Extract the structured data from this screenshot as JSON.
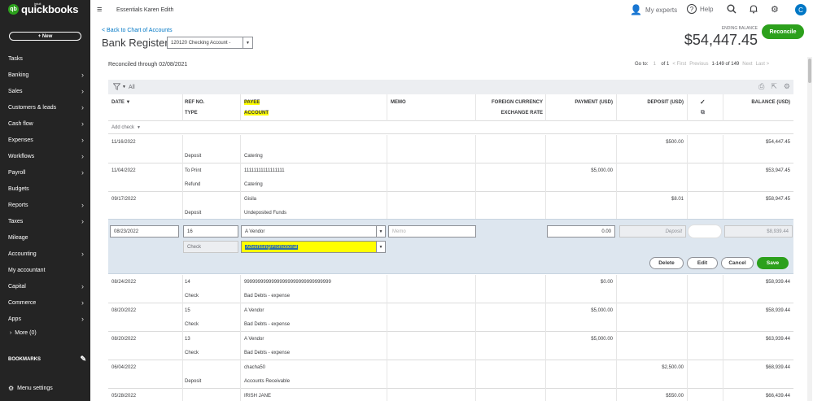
{
  "sidebar": {
    "logo_intuit": "intuit",
    "logo_text": "quickbooks",
    "new_label": "+ New",
    "items": [
      {
        "label": "Tasks",
        "chevron": false
      },
      {
        "label": "Banking",
        "chevron": true
      },
      {
        "label": "Sales",
        "chevron": true
      },
      {
        "label": "Customers & leads",
        "chevron": true
      },
      {
        "label": "Cash flow",
        "chevron": true
      },
      {
        "label": "Expenses",
        "chevron": true
      },
      {
        "label": "Workflows",
        "chevron": true
      },
      {
        "label": "Payroll",
        "chevron": true
      },
      {
        "label": "Budgets",
        "chevron": false
      },
      {
        "label": "Reports",
        "chevron": true
      },
      {
        "label": "Taxes",
        "chevron": true
      },
      {
        "label": "Mileage",
        "chevron": false
      },
      {
        "label": "Accounting",
        "chevron": true
      },
      {
        "label": "My accountant",
        "chevron": false
      },
      {
        "label": "Capital",
        "chevron": true
      },
      {
        "label": "Commerce",
        "chevron": true
      },
      {
        "label": "Apps",
        "chevron": true
      }
    ],
    "more_label": "More (0)",
    "bookmarks_label": "BOOKMARKS",
    "menu_settings_label": "Menu settings"
  },
  "topbar": {
    "company": "Essentials Karen Edith",
    "my_experts": "My experts",
    "help": "Help",
    "avatar_initial": "C"
  },
  "header": {
    "back_link": "< Back to Chart of Accounts",
    "title": "Bank Register",
    "account_value": "120120 Checking Account -",
    "ending_balance_label": "ENDING BALANCE",
    "ending_balance_value": "$54,447.45",
    "reconcile_label": "Reconcile"
  },
  "status": {
    "reconciled": "Reconciled through 02/08/2021",
    "goto_label": "Go to:",
    "goto_value": "1",
    "of_pages": "of 1",
    "first": "< First",
    "previous": "Previous",
    "range": "1-149 of 149",
    "next": "Next",
    "last": "Last >"
  },
  "filter": {
    "all_label": "All"
  },
  "columns": {
    "date": "DATE ▼",
    "ref_no": "REF NO.",
    "type": "TYPE",
    "payee": "PAYEE",
    "account": "ACCOUNT",
    "memo": "MEMO",
    "foreign_currency": "FOREIGN CURRENCY",
    "exchange_rate": "EXCHANGE RATE",
    "payment": "PAYMENT (USD)",
    "deposit": "DEPOSIT (USD)",
    "balance": "BALANCE (USD)"
  },
  "add_check_label": "Add check",
  "rows_above": [
    {
      "date": "11/16/2022",
      "ref": "",
      "type": "Deposit",
      "payee": "",
      "account": "Catering",
      "payment": "",
      "deposit": "$500.00",
      "balance": "$54,447.45"
    },
    {
      "date": "11/04/2022",
      "ref": "To Print",
      "type": "Refund",
      "payee": "11111111111111111",
      "account": "Catering",
      "payment": "$5,000.00",
      "deposit": "",
      "balance": "$53,947.45"
    },
    {
      "date": "09/17/2022",
      "ref": "",
      "type": "Deposit",
      "payee": "Gisila",
      "account": "Undeposited Funds",
      "payment": "",
      "deposit": "$8.01",
      "balance": "$58,947.45"
    }
  ],
  "edit_row": {
    "date": "08/23/2022",
    "ref": "16",
    "payee": "A Vendor",
    "memo_placeholder": "Memo",
    "payment": "0.00",
    "deposit_placeholder": "Deposit",
    "balance": "$8,939.44",
    "type": "Check",
    "account": "Advertising/Promotional",
    "delete_label": "Delete",
    "edit_label": "Edit",
    "cancel_label": "Cancel",
    "save_label": "Save"
  },
  "rows_below": [
    {
      "date": "08/24/2022",
      "ref": "14",
      "type": "Check",
      "payee": "99999999999999999999999999999999",
      "account": "Bad Debts - expense",
      "payment": "$0.00",
      "deposit": "",
      "balance": "$58,939.44"
    },
    {
      "date": "08/20/2022",
      "ref": "15",
      "type": "Check",
      "payee": "A Vendor",
      "account": "Bad Debts - expense",
      "payment": "$5,000.00",
      "deposit": "",
      "balance": "$58,939.44"
    },
    {
      "date": "08/20/2022",
      "ref": "13",
      "type": "Check",
      "payee": "A Vendor",
      "account": "Bad Debts - expense",
      "payment": "$5,000.00",
      "deposit": "",
      "balance": "$63,939.44"
    },
    {
      "date": "06/04/2022",
      "ref": "",
      "type": "Deposit",
      "payee": "chacha50",
      "account": "Accounts Receivable",
      "payment": "",
      "deposit": "$2,500.00",
      "balance": "$68,939.44"
    },
    {
      "date": "05/28/2022",
      "ref": "",
      "type": "",
      "payee": "IRISH JANE",
      "account": "",
      "payment": "",
      "deposit": "$550.00",
      "balance": "$66,439.44"
    }
  ],
  "colors": {
    "brand_green": "#2ca01c",
    "sidebar_bg": "#242424",
    "highlight": "#ffff00",
    "link": "#0077c5"
  }
}
